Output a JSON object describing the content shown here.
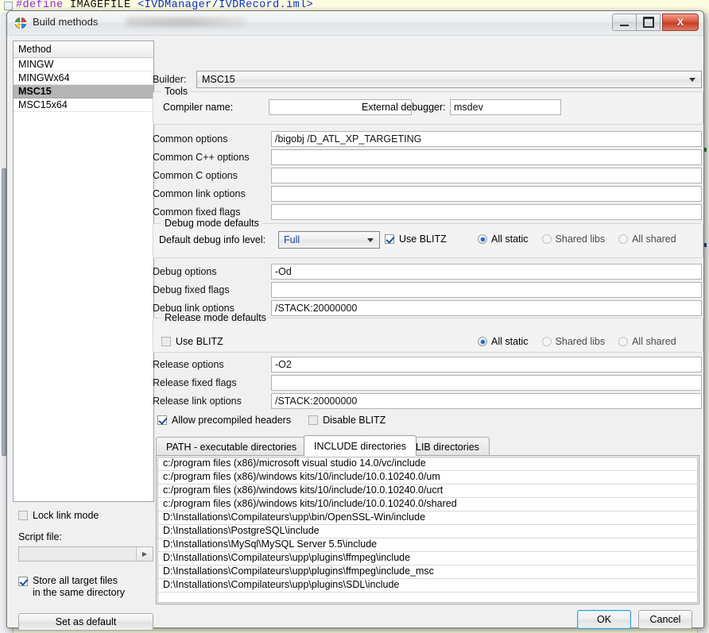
{
  "background": {
    "code_line": {
      "directive": "#define",
      "symbol": "IMAGEFILE",
      "value": "<IVDManager/IVDRecord.iml>"
    }
  },
  "dialog": {
    "title": "Build methods",
    "icon": "upp-rainbow-icon",
    "window_buttons": {
      "minimize": "–",
      "maximize": "□",
      "close": "X"
    }
  },
  "methods": {
    "header": "Method",
    "items": [
      {
        "label": "MINGW",
        "selected": false
      },
      {
        "label": "MINGWx64",
        "selected": false
      },
      {
        "label": "MSC15",
        "selected": true
      },
      {
        "label": "MSC15x64",
        "selected": false
      }
    ]
  },
  "sidebar": {
    "lock_link_mode": "Lock link mode",
    "script_file_label": "Script file:",
    "script_file_value": "",
    "script_browse_icon": "play-arrow-icon",
    "store_all_line1": "Store all target files",
    "store_all_line2": "in the same directory",
    "set_as_default": "Set as default"
  },
  "builder": {
    "label": "Builder:",
    "value": "MSC15"
  },
  "tools": {
    "title": "Tools",
    "compiler_label": "Compiler name:",
    "compiler_value": "",
    "external_debugger_label": "External debugger:",
    "external_debugger_value": "msdev"
  },
  "common": [
    {
      "label": "Common options",
      "value": "/bigobj /D_ATL_XP_TARGETING"
    },
    {
      "label": "Common C++ options",
      "value": ""
    },
    {
      "label": "Common C options",
      "value": ""
    },
    {
      "label": "Common link options",
      "value": ""
    },
    {
      "label": "Common fixed flags",
      "value": ""
    }
  ],
  "debug_group": {
    "title": "Debug mode defaults",
    "level_label": "Default debug info level:",
    "level_value": "Full",
    "use_blitz_label": "Use BLITZ",
    "use_blitz_checked": true,
    "link_modes": [
      {
        "label": "All static",
        "selected": true
      },
      {
        "label": "Shared libs",
        "selected": false
      },
      {
        "label": "All shared",
        "selected": false
      }
    ]
  },
  "debug_fields": [
    {
      "label": "Debug options",
      "value": "-Od"
    },
    {
      "label": "Debug fixed flags",
      "value": ""
    },
    {
      "label": "Debug link options",
      "value": "/STACK:20000000"
    }
  ],
  "release_group": {
    "title": "Release mode defaults",
    "use_blitz_label": "Use BLITZ",
    "use_blitz_checked": false,
    "link_modes": [
      {
        "label": "All static",
        "selected": true
      },
      {
        "label": "Shared libs",
        "selected": false
      },
      {
        "label": "All shared",
        "selected": false
      }
    ]
  },
  "release_fields": [
    {
      "label": "Release options",
      "value": "-O2"
    },
    {
      "label": "Release fixed flags",
      "value": ""
    },
    {
      "label": "Release link options",
      "value": "/STACK:20000000"
    }
  ],
  "bottom_checks": [
    {
      "label": "Allow precompiled headers",
      "checked": true
    },
    {
      "label": "Disable BLITZ",
      "checked": false
    }
  ],
  "tabs": [
    {
      "label": "PATH - executable directories",
      "active": false
    },
    {
      "label": "INCLUDE directories",
      "active": true
    },
    {
      "label": "LIB directories",
      "active": false
    }
  ],
  "include_directories": [
    "c:/program files (x86)/microsoft visual studio 14.0/vc/include",
    "c:/program files (x86)/windows kits/10/include/10.0.10240.0/um",
    "c:/program files (x86)/windows kits/10/include/10.0.10240.0/ucrt",
    "c:/program files (x86)/windows kits/10/include/10.0.10240.0/shared",
    "D:\\Installations\\Compilateurs\\upp\\bin/OpenSSL-Win/include",
    "D:\\Installations\\PostgreSQL\\include",
    "D:\\Installations\\MySql\\MySQL Server 5.5\\include",
    "D:\\Installations\\Compilateurs\\upp\\plugins\\ffmpeg\\include",
    "D:\\Installations\\Compilateurs\\upp\\plugins\\ffmpeg\\include_msc",
    "D:\\Installations\\Compilateurs\\upp\\plugins\\SDL\\include"
  ],
  "footer": {
    "ok": "OK",
    "cancel": "Cancel"
  },
  "colors": {
    "accent": "#1668c8",
    "selection": "#b4b4b4",
    "close_button": "#c13d26",
    "focus_text": "#1b3fa0"
  }
}
